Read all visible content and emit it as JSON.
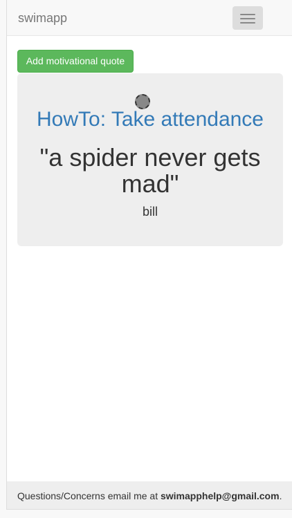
{
  "navbar": {
    "brand": "swimapp",
    "toggle_icon": "hamburger-menu-icon"
  },
  "actions": {
    "add_quote_label": "Add motivational quote"
  },
  "loading_icon": "loading-spinner-icon",
  "jumbotron": {
    "howto_link": "HowTo: Take attendance",
    "quote": "\"a spider never gets mad\"",
    "author": "bill"
  },
  "footer": {
    "prefix": "Questions/Concerns email me at ",
    "email": "swimapphelp@gmail.com",
    "suffix": "."
  },
  "colors": {
    "primary_link": "#337ab7",
    "success_button": "#5cb85c",
    "jumbotron_bg": "#eeeeee",
    "navbar_bg": "#f8f8f8"
  }
}
